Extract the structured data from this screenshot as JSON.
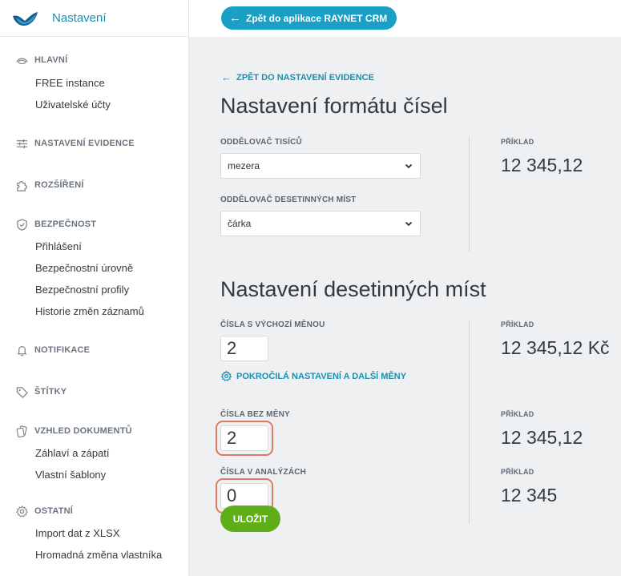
{
  "sidebar": {
    "brand_title": "Nastavení",
    "sections": [
      {
        "label": "HLAVNÍ",
        "icon": "dashboard-icon",
        "items": [
          "FREE instance",
          "Uživatelské účty"
        ]
      },
      {
        "label": "NASTAVENÍ EVIDENCE",
        "icon": "sliders-icon",
        "items": []
      },
      {
        "label": "ROZŠÍŘENÍ",
        "icon": "puzzle-icon",
        "items": []
      },
      {
        "label": "BEZPEČNOST",
        "icon": "shield-icon",
        "items": [
          "Přihlášení",
          "Bezpečnostní úrovně",
          "Bezpečnostní profily",
          "Historie změn záznamů"
        ]
      },
      {
        "label": "NOTIFIKACE",
        "icon": "bell-icon",
        "items": []
      },
      {
        "label": "ŠTÍTKY",
        "icon": "tag-icon",
        "items": []
      },
      {
        "label": "VZHLED DOKUMENTŮ",
        "icon": "documents-icon",
        "items": [
          "Záhlaví a zápatí",
          "Vlastní šablony"
        ]
      },
      {
        "label": "OSTATNÍ",
        "icon": "gear-icon",
        "items": [
          "Import dat z XLSX",
          "Hromadná změna vlastníka"
        ]
      }
    ]
  },
  "topbar": {
    "back_app": "Zpět do aplikace RAYNET CRM"
  },
  "main": {
    "back_link": "ZPĚT DO NASTAVENÍ EVIDENCE",
    "number_format": {
      "title": "Nastavení formátu čísel",
      "thousands_label": "ODDĚLOVAČ TISÍCŮ",
      "thousands_value": "mezera",
      "decimal_label": "ODDĚLOVAČ DESETINNÝCH MÍST",
      "decimal_value": "čárka",
      "example_label": "PŘÍKLAD",
      "example_value": "12 345,12"
    },
    "decimal_places": {
      "title": "Nastavení desetinných míst",
      "default_currency_label": "ČÍSLA S VÝCHOZÍ MĚNOU",
      "default_currency_value": "2",
      "default_currency_example_label": "PŘÍKLAD",
      "default_currency_example": "12 345,12 Kč",
      "advanced_link": "POKROČILÁ NASTAVENÍ A DALŠÍ MĚNY",
      "no_currency_label": "ČÍSLA BEZ MĚNY",
      "no_currency_value": "2",
      "no_currency_example_label": "PŘÍKLAD",
      "no_currency_example": "12 345,12",
      "analysis_label": "ČÍSLA V ANALÝZÁCH",
      "analysis_value": "0",
      "analysis_example_label": "PŘÍKLAD",
      "analysis_example": "12 345"
    },
    "save_label": "ULOŽIT"
  },
  "colors": {
    "accent": "#1a9fc6",
    "save": "#5fae18",
    "highlight": "#e07a61"
  }
}
